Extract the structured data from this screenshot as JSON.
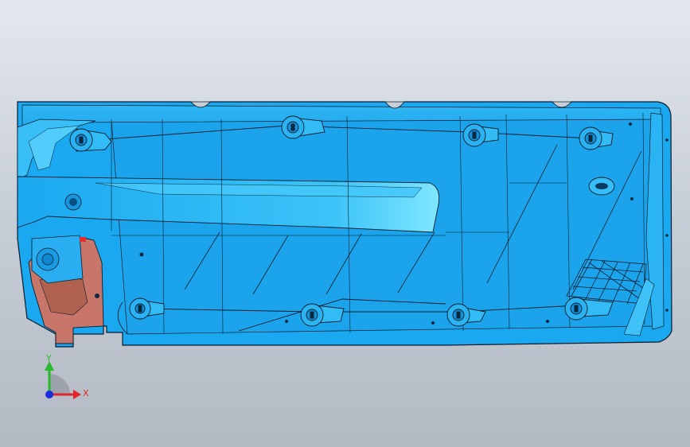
{
  "viewport": {
    "background_top": "#e4e8ee",
    "background_bottom": "#b4bac4"
  },
  "model": {
    "part_color": "#1aa8f0",
    "part_highlight": "#5fd6ff",
    "part_shadow": "#0c7fc4",
    "edge_color": "#0a1c2a",
    "section_color": "#c8766a"
  },
  "triad": {
    "x_label": "X",
    "y_label": "Y",
    "x_color": "#e0262a",
    "y_color": "#2ab82e",
    "z_color": "#1a2ce0"
  }
}
